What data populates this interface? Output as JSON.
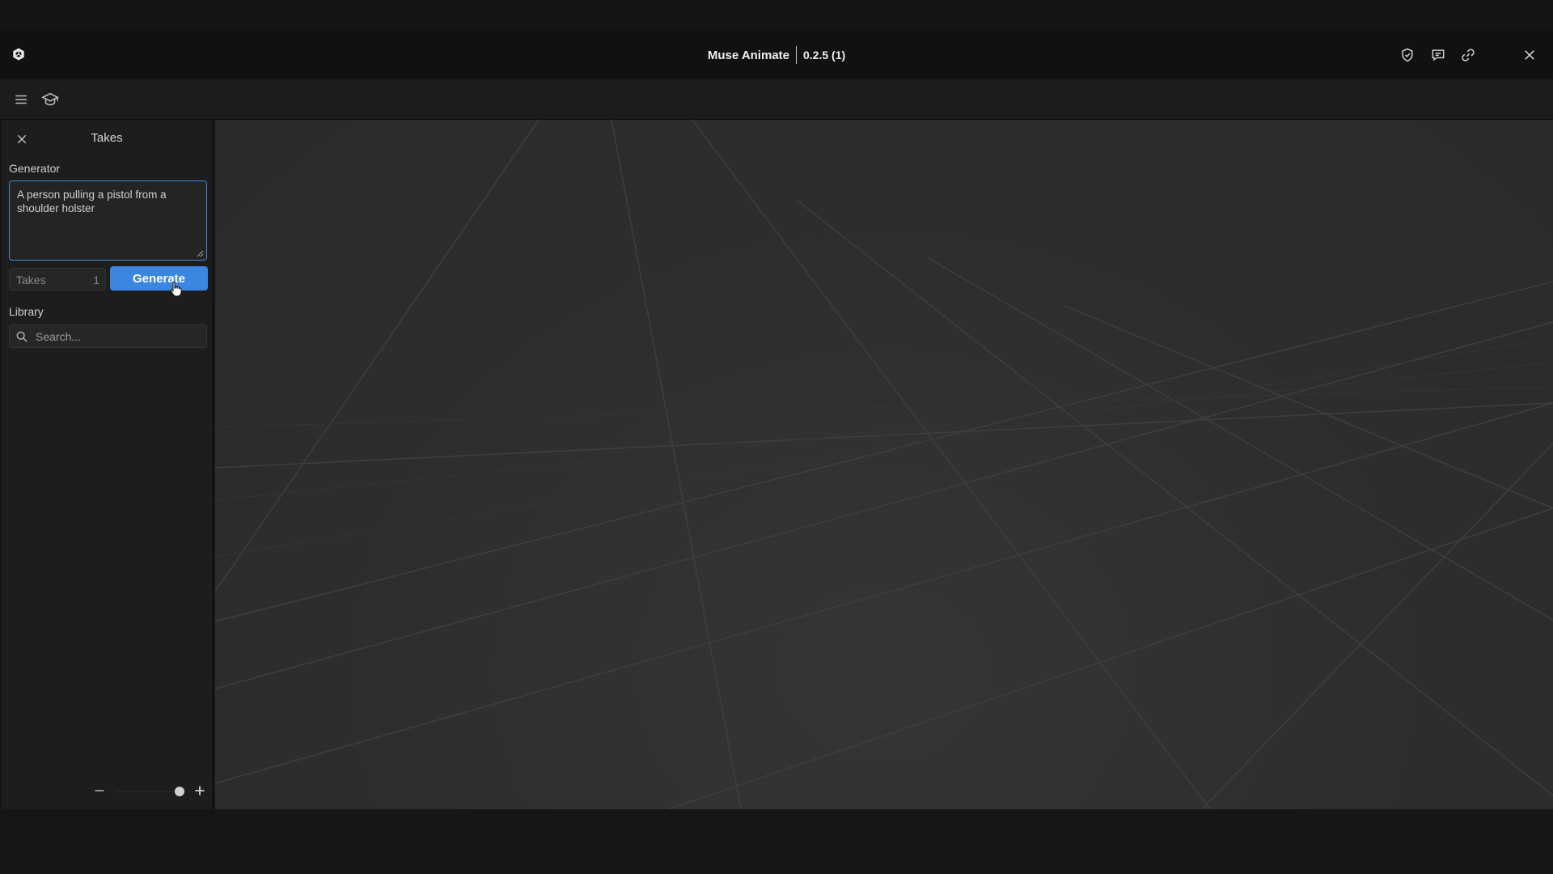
{
  "window": {
    "app_name": "Muse Animate",
    "version": "0.2.5 (1)"
  },
  "titlebar": {
    "icons": [
      "shield-check-icon",
      "chat-icon",
      "link-icon",
      "close-icon"
    ]
  },
  "toolbar": {
    "icons": [
      "hamburger-menu-icon",
      "graduation-cap-icon"
    ]
  },
  "sidepanel": {
    "title": "Takes",
    "generator_label": "Generator",
    "prompt_value": "A person pulling a pistol from a shoulder holster",
    "takes_label": "Takes",
    "takes_value": "1",
    "generate_label": "Generate",
    "library_label": "Library",
    "search_placeholder": "Search..."
  },
  "zoom": {
    "level": 0.95
  },
  "colors": {
    "accent": "#3a86e0",
    "panel_bg": "#1d1d1d",
    "viewport_bg": "#2c2d2e"
  }
}
